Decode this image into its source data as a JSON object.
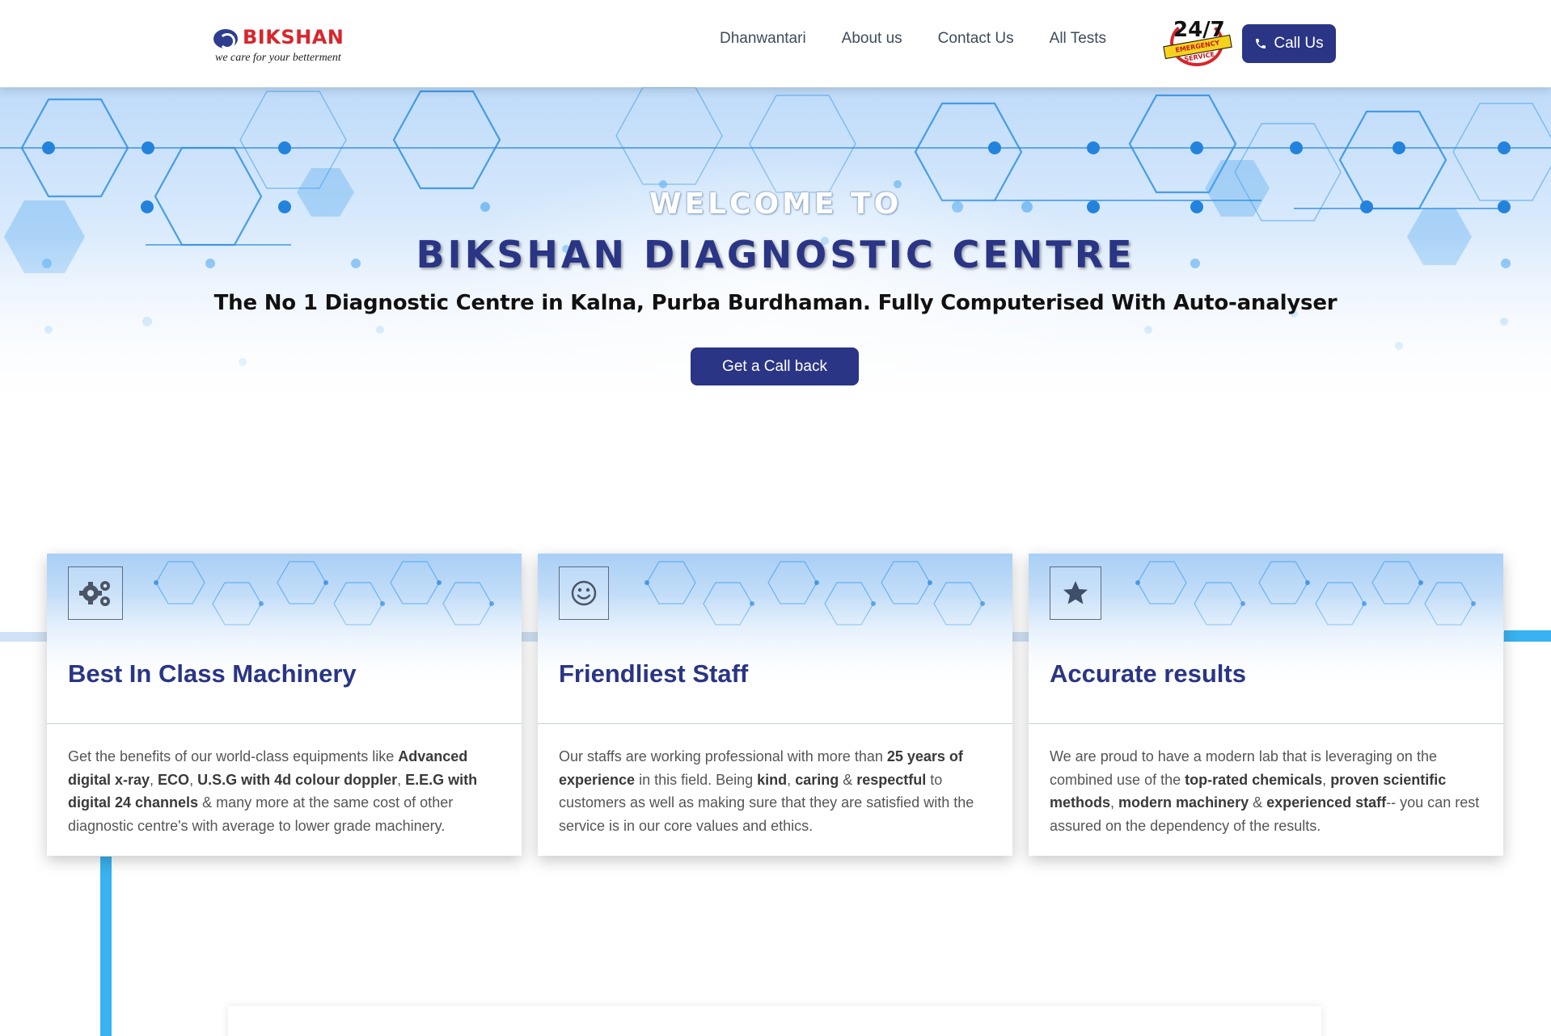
{
  "header": {
    "logo": {
      "name": "BIKSHAN",
      "tagline": "we care for your betterment"
    },
    "nav": [
      {
        "label": "Dhanwantari"
      },
      {
        "label": "About us"
      },
      {
        "label": "Contact Us"
      },
      {
        "label": "All Tests"
      }
    ],
    "badge": {
      "number": "24/7",
      "ribbon": "EMERGENCY SERVICE"
    },
    "call_button": {
      "label": "Call Us",
      "icon": "phone-icon"
    }
  },
  "hero": {
    "welcome": "WELCOME TO",
    "title": "BIKSHAN DIAGNOSTIC CENTRE",
    "subtitle": "The No 1 Diagnostic Centre in Kalna, Purba Burdhaman. Fully Computerised With Auto-analyser",
    "button": "Get a Call back"
  },
  "cards": [
    {
      "icon": "gears-icon",
      "title": "Best In Class Machinery",
      "text": [
        {
          "t": "Get the benefits of our world-class equipments like ",
          "b": false
        },
        {
          "t": "Advanced digital x-ray",
          "b": true
        },
        {
          "t": ", ",
          "b": false
        },
        {
          "t": "ECO",
          "b": true
        },
        {
          "t": ", ",
          "b": false
        },
        {
          "t": "U.S.G with 4d colour doppler",
          "b": true
        },
        {
          "t": ", ",
          "b": false
        },
        {
          "t": "E.E.G with digital 24 channels",
          "b": true
        },
        {
          "t": " & many more at the same cost of other diagnostic centre's with average to lower grade machinery.",
          "b": false
        }
      ]
    },
    {
      "icon": "smiley-icon",
      "title": "Friendliest Staff",
      "text": [
        {
          "t": "Our staffs are working professional with more than ",
          "b": false
        },
        {
          "t": "25 years of experience",
          "b": true
        },
        {
          "t": " in this field. Being ",
          "b": false
        },
        {
          "t": "kind",
          "b": true
        },
        {
          "t": ", ",
          "b": false
        },
        {
          "t": "caring",
          "b": true
        },
        {
          "t": " & ",
          "b": false
        },
        {
          "t": "respectful",
          "b": true
        },
        {
          "t": " to customers as well as making sure that they are satisfied with the service is in our core values and ethics.",
          "b": false
        }
      ]
    },
    {
      "icon": "star-icon",
      "title": "Accurate results",
      "text": [
        {
          "t": "We are proud to have a modern lab that is leveraging on the combined use of the ",
          "b": false
        },
        {
          "t": "top-rated chemicals",
          "b": true
        },
        {
          "t": ", ",
          "b": false
        },
        {
          "t": "proven scientific methods",
          "b": true
        },
        {
          "t": ", ",
          "b": false
        },
        {
          "t": "modern machinery",
          "b": true
        },
        {
          "t": " & ",
          "b": false
        },
        {
          "t": "experienced staff",
          "b": true
        },
        {
          "t": "-- you can rest assured on the dependency of the results.",
          "b": false
        }
      ]
    }
  ],
  "colors": {
    "primary": "#2a3585",
    "accent_blue": "#38b2f0",
    "logo_red": "#d8262c"
  }
}
